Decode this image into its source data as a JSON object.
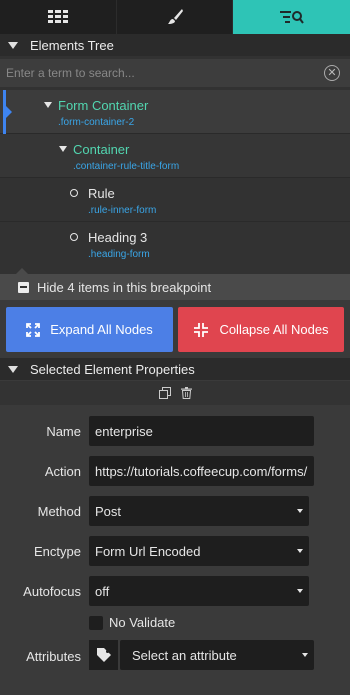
{
  "toolbar": {
    "tabs": [
      {
        "icon": "grid-icon",
        "active": false
      },
      {
        "icon": "brush-icon",
        "active": false
      },
      {
        "icon": "tree-search-icon",
        "active": true
      }
    ],
    "active_color": "#2ec4b6"
  },
  "elements_tree": {
    "header": "Elements Tree",
    "search_placeholder": "Enter a term to search...",
    "nodes": [
      {
        "title": "Form Container",
        "class": ".form-container-2",
        "selected": true,
        "expandable": true
      },
      {
        "title": "Container",
        "class": ".container-rule-title-form",
        "selected": false,
        "expandable": true
      },
      {
        "title": "Rule",
        "class": ".rule-inner-form",
        "selected": false,
        "expandable": false
      },
      {
        "title": "Heading 3",
        "class": ".heading-form",
        "selected": false,
        "expandable": false
      }
    ],
    "hide_label": "Hide 4 items in this breakpoint"
  },
  "actions": {
    "expand_label": "Expand All Nodes",
    "collapse_label": "Collapse All Nodes",
    "expand_color": "#4c7fe6",
    "collapse_color": "#e0454f"
  },
  "properties": {
    "header": "Selected Element Properties",
    "name_label": "Name",
    "name_value": "enterprise",
    "action_label": "Action",
    "action_value": "https://tutorials.coffeecup.com/forms/",
    "method_label": "Method",
    "method_value": "Post",
    "enctype_label": "Enctype",
    "enctype_value": "Form Url Encoded",
    "autofocus_label": "Autofocus",
    "autofocus_value": "off",
    "novalidate_label": "No Validate",
    "novalidate_checked": false,
    "attributes_label": "Attributes",
    "attributes_placeholder": "Select an attribute"
  }
}
